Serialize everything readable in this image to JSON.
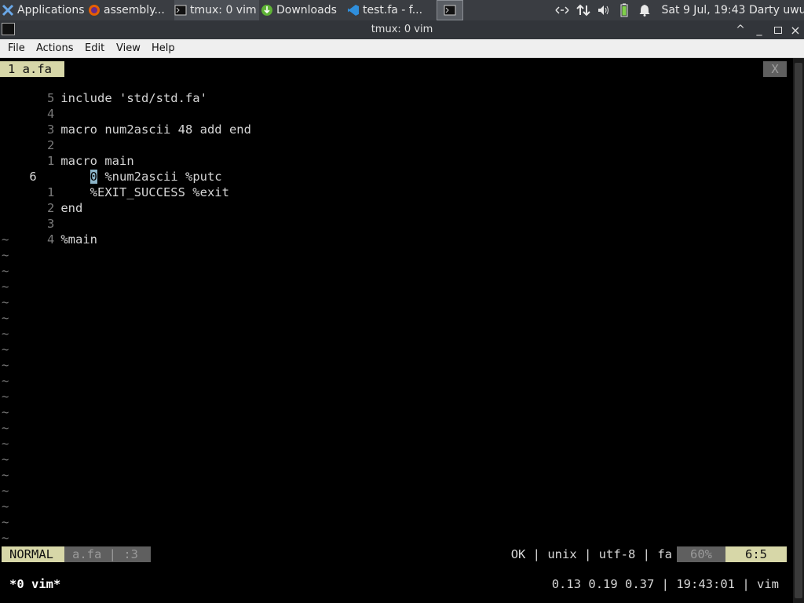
{
  "panel": {
    "apps_label": "Applications",
    "apps_suffix": "☰",
    "tasks": [
      {
        "label": "assembly..."
      },
      {
        "label": "tmux: 0 vim"
      },
      {
        "label": "Downloads"
      },
      {
        "label": "test.fa - f..."
      }
    ],
    "clock": "Sat  9 Jul, 19:43",
    "user": "Darty uwu"
  },
  "window": {
    "title": "tmux: 0 vim",
    "minimize": "_",
    "up": "^",
    "close": "×"
  },
  "menubar": {
    "items": [
      "File",
      "Actions",
      "Edit",
      "View",
      "Help"
    ]
  },
  "vim": {
    "tab_label": "1 a.fa",
    "tab_close": "X",
    "lines": [
      {
        "num": "5",
        "text": "include 'std/std.fa'"
      },
      {
        "num": "4",
        "text": ""
      },
      {
        "num": "3",
        "text": "macro num2ascii 48 add end"
      },
      {
        "num": "2",
        "text": ""
      },
      {
        "num": "1",
        "text": "macro main"
      },
      {
        "num": "6",
        "text": "    0 %num2ascii %putc"
      },
      {
        "num": "1",
        "text": "    %EXIT_SUCCESS %exit"
      },
      {
        "num": "2",
        "text": "end"
      },
      {
        "num": "3",
        "text": ""
      },
      {
        "num": "4",
        "text": "%main"
      }
    ],
    "tilde": "~",
    "cursor_char": "0",
    "status": {
      "mode": "NORMAL",
      "file": "a.fa | :3",
      "info": "OK | unix | utf-8 | fa",
      "percent": "60%",
      "position": "6:5"
    }
  },
  "tmux": {
    "window": "*0 vim*",
    "right": "0.13 0.19 0.37 | 19:43:01 | vim"
  },
  "colors": {
    "accent": "#d7d7a8",
    "panel_bg": "#3a3d42",
    "terminal_bg": "#000000"
  }
}
